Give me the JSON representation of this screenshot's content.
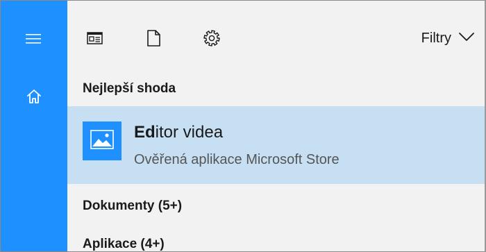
{
  "sidebar": {
    "menu_icon": "hamburger-menu-icon",
    "home_icon": "home-icon"
  },
  "toolbar": {
    "icons": [
      "news-icon",
      "document-icon",
      "gear-icon"
    ],
    "filters_label": "Filtry"
  },
  "sections": {
    "best_match_heading": "Nejlepší shoda",
    "documents_heading": "Dokumenty (5+)",
    "apps_heading": "Aplikace (4+)"
  },
  "best_match": {
    "title_highlight": "Ed",
    "title_rest": "itor videa",
    "subtitle": "Ověřená aplikace Microsoft Store",
    "icon": "photo-icon"
  },
  "colors": {
    "accent": "#1e90ff",
    "selection": "#c6dff2",
    "background": "#f2f2f2"
  }
}
